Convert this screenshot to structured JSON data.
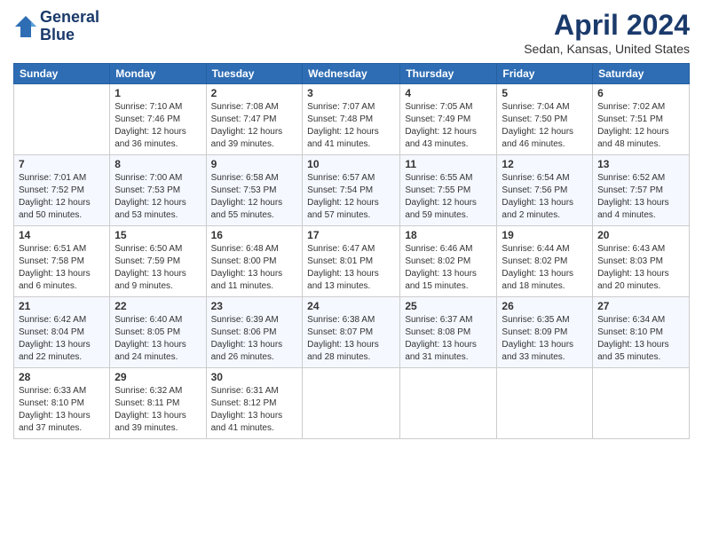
{
  "header": {
    "logo_line1": "General",
    "logo_line2": "Blue",
    "title": "April 2024",
    "subtitle": "Sedan, Kansas, United States"
  },
  "weekdays": [
    "Sunday",
    "Monday",
    "Tuesday",
    "Wednesday",
    "Thursday",
    "Friday",
    "Saturday"
  ],
  "weeks": [
    [
      {
        "day": "",
        "sunrise": "",
        "sunset": "",
        "daylight": ""
      },
      {
        "day": "1",
        "sunrise": "Sunrise: 7:10 AM",
        "sunset": "Sunset: 7:46 PM",
        "daylight": "Daylight: 12 hours and 36 minutes."
      },
      {
        "day": "2",
        "sunrise": "Sunrise: 7:08 AM",
        "sunset": "Sunset: 7:47 PM",
        "daylight": "Daylight: 12 hours and 39 minutes."
      },
      {
        "day": "3",
        "sunrise": "Sunrise: 7:07 AM",
        "sunset": "Sunset: 7:48 PM",
        "daylight": "Daylight: 12 hours and 41 minutes."
      },
      {
        "day": "4",
        "sunrise": "Sunrise: 7:05 AM",
        "sunset": "Sunset: 7:49 PM",
        "daylight": "Daylight: 12 hours and 43 minutes."
      },
      {
        "day": "5",
        "sunrise": "Sunrise: 7:04 AM",
        "sunset": "Sunset: 7:50 PM",
        "daylight": "Daylight: 12 hours and 46 minutes."
      },
      {
        "day": "6",
        "sunrise": "Sunrise: 7:02 AM",
        "sunset": "Sunset: 7:51 PM",
        "daylight": "Daylight: 12 hours and 48 minutes."
      }
    ],
    [
      {
        "day": "7",
        "sunrise": "Sunrise: 7:01 AM",
        "sunset": "Sunset: 7:52 PM",
        "daylight": "Daylight: 12 hours and 50 minutes."
      },
      {
        "day": "8",
        "sunrise": "Sunrise: 7:00 AM",
        "sunset": "Sunset: 7:53 PM",
        "daylight": "Daylight: 12 hours and 53 minutes."
      },
      {
        "day": "9",
        "sunrise": "Sunrise: 6:58 AM",
        "sunset": "Sunset: 7:53 PM",
        "daylight": "Daylight: 12 hours and 55 minutes."
      },
      {
        "day": "10",
        "sunrise": "Sunrise: 6:57 AM",
        "sunset": "Sunset: 7:54 PM",
        "daylight": "Daylight: 12 hours and 57 minutes."
      },
      {
        "day": "11",
        "sunrise": "Sunrise: 6:55 AM",
        "sunset": "Sunset: 7:55 PM",
        "daylight": "Daylight: 12 hours and 59 minutes."
      },
      {
        "day": "12",
        "sunrise": "Sunrise: 6:54 AM",
        "sunset": "Sunset: 7:56 PM",
        "daylight": "Daylight: 13 hours and 2 minutes."
      },
      {
        "day": "13",
        "sunrise": "Sunrise: 6:52 AM",
        "sunset": "Sunset: 7:57 PM",
        "daylight": "Daylight: 13 hours and 4 minutes."
      }
    ],
    [
      {
        "day": "14",
        "sunrise": "Sunrise: 6:51 AM",
        "sunset": "Sunset: 7:58 PM",
        "daylight": "Daylight: 13 hours and 6 minutes."
      },
      {
        "day": "15",
        "sunrise": "Sunrise: 6:50 AM",
        "sunset": "Sunset: 7:59 PM",
        "daylight": "Daylight: 13 hours and 9 minutes."
      },
      {
        "day": "16",
        "sunrise": "Sunrise: 6:48 AM",
        "sunset": "Sunset: 8:00 PM",
        "daylight": "Daylight: 13 hours and 11 minutes."
      },
      {
        "day": "17",
        "sunrise": "Sunrise: 6:47 AM",
        "sunset": "Sunset: 8:01 PM",
        "daylight": "Daylight: 13 hours and 13 minutes."
      },
      {
        "day": "18",
        "sunrise": "Sunrise: 6:46 AM",
        "sunset": "Sunset: 8:02 PM",
        "daylight": "Daylight: 13 hours and 15 minutes."
      },
      {
        "day": "19",
        "sunrise": "Sunrise: 6:44 AM",
        "sunset": "Sunset: 8:02 PM",
        "daylight": "Daylight: 13 hours and 18 minutes."
      },
      {
        "day": "20",
        "sunrise": "Sunrise: 6:43 AM",
        "sunset": "Sunset: 8:03 PM",
        "daylight": "Daylight: 13 hours and 20 minutes."
      }
    ],
    [
      {
        "day": "21",
        "sunrise": "Sunrise: 6:42 AM",
        "sunset": "Sunset: 8:04 PM",
        "daylight": "Daylight: 13 hours and 22 minutes."
      },
      {
        "day": "22",
        "sunrise": "Sunrise: 6:40 AM",
        "sunset": "Sunset: 8:05 PM",
        "daylight": "Daylight: 13 hours and 24 minutes."
      },
      {
        "day": "23",
        "sunrise": "Sunrise: 6:39 AM",
        "sunset": "Sunset: 8:06 PM",
        "daylight": "Daylight: 13 hours and 26 minutes."
      },
      {
        "day": "24",
        "sunrise": "Sunrise: 6:38 AM",
        "sunset": "Sunset: 8:07 PM",
        "daylight": "Daylight: 13 hours and 28 minutes."
      },
      {
        "day": "25",
        "sunrise": "Sunrise: 6:37 AM",
        "sunset": "Sunset: 8:08 PM",
        "daylight": "Daylight: 13 hours and 31 minutes."
      },
      {
        "day": "26",
        "sunrise": "Sunrise: 6:35 AM",
        "sunset": "Sunset: 8:09 PM",
        "daylight": "Daylight: 13 hours and 33 minutes."
      },
      {
        "day": "27",
        "sunrise": "Sunrise: 6:34 AM",
        "sunset": "Sunset: 8:10 PM",
        "daylight": "Daylight: 13 hours and 35 minutes."
      }
    ],
    [
      {
        "day": "28",
        "sunrise": "Sunrise: 6:33 AM",
        "sunset": "Sunset: 8:10 PM",
        "daylight": "Daylight: 13 hours and 37 minutes."
      },
      {
        "day": "29",
        "sunrise": "Sunrise: 6:32 AM",
        "sunset": "Sunset: 8:11 PM",
        "daylight": "Daylight: 13 hours and 39 minutes."
      },
      {
        "day": "30",
        "sunrise": "Sunrise: 6:31 AM",
        "sunset": "Sunset: 8:12 PM",
        "daylight": "Daylight: 13 hours and 41 minutes."
      },
      {
        "day": "",
        "sunrise": "",
        "sunset": "",
        "daylight": ""
      },
      {
        "day": "",
        "sunrise": "",
        "sunset": "",
        "daylight": ""
      },
      {
        "day": "",
        "sunrise": "",
        "sunset": "",
        "daylight": ""
      },
      {
        "day": "",
        "sunrise": "",
        "sunset": "",
        "daylight": ""
      }
    ]
  ]
}
